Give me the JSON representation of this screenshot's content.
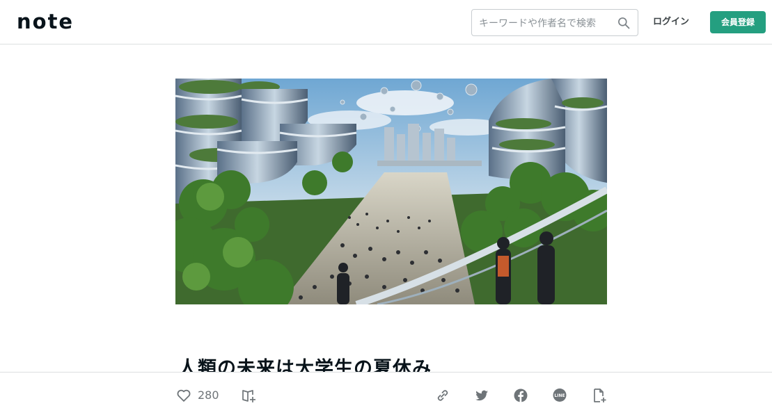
{
  "header": {
    "logo_text": "note",
    "search_placeholder": "キーワードや作者名で検索",
    "login_label": "ログイン",
    "signup_label": "会員登録",
    "accent_color": "#249f80"
  },
  "article": {
    "title": "人類の未来は大学生の夏休み"
  },
  "actions": {
    "like_count": "280",
    "icons": [
      "heart-icon",
      "magazine-add-icon",
      "link-icon",
      "twitter-icon",
      "facebook-icon",
      "line-icon",
      "note-embed-icon"
    ],
    "line_text": "LINE"
  }
}
